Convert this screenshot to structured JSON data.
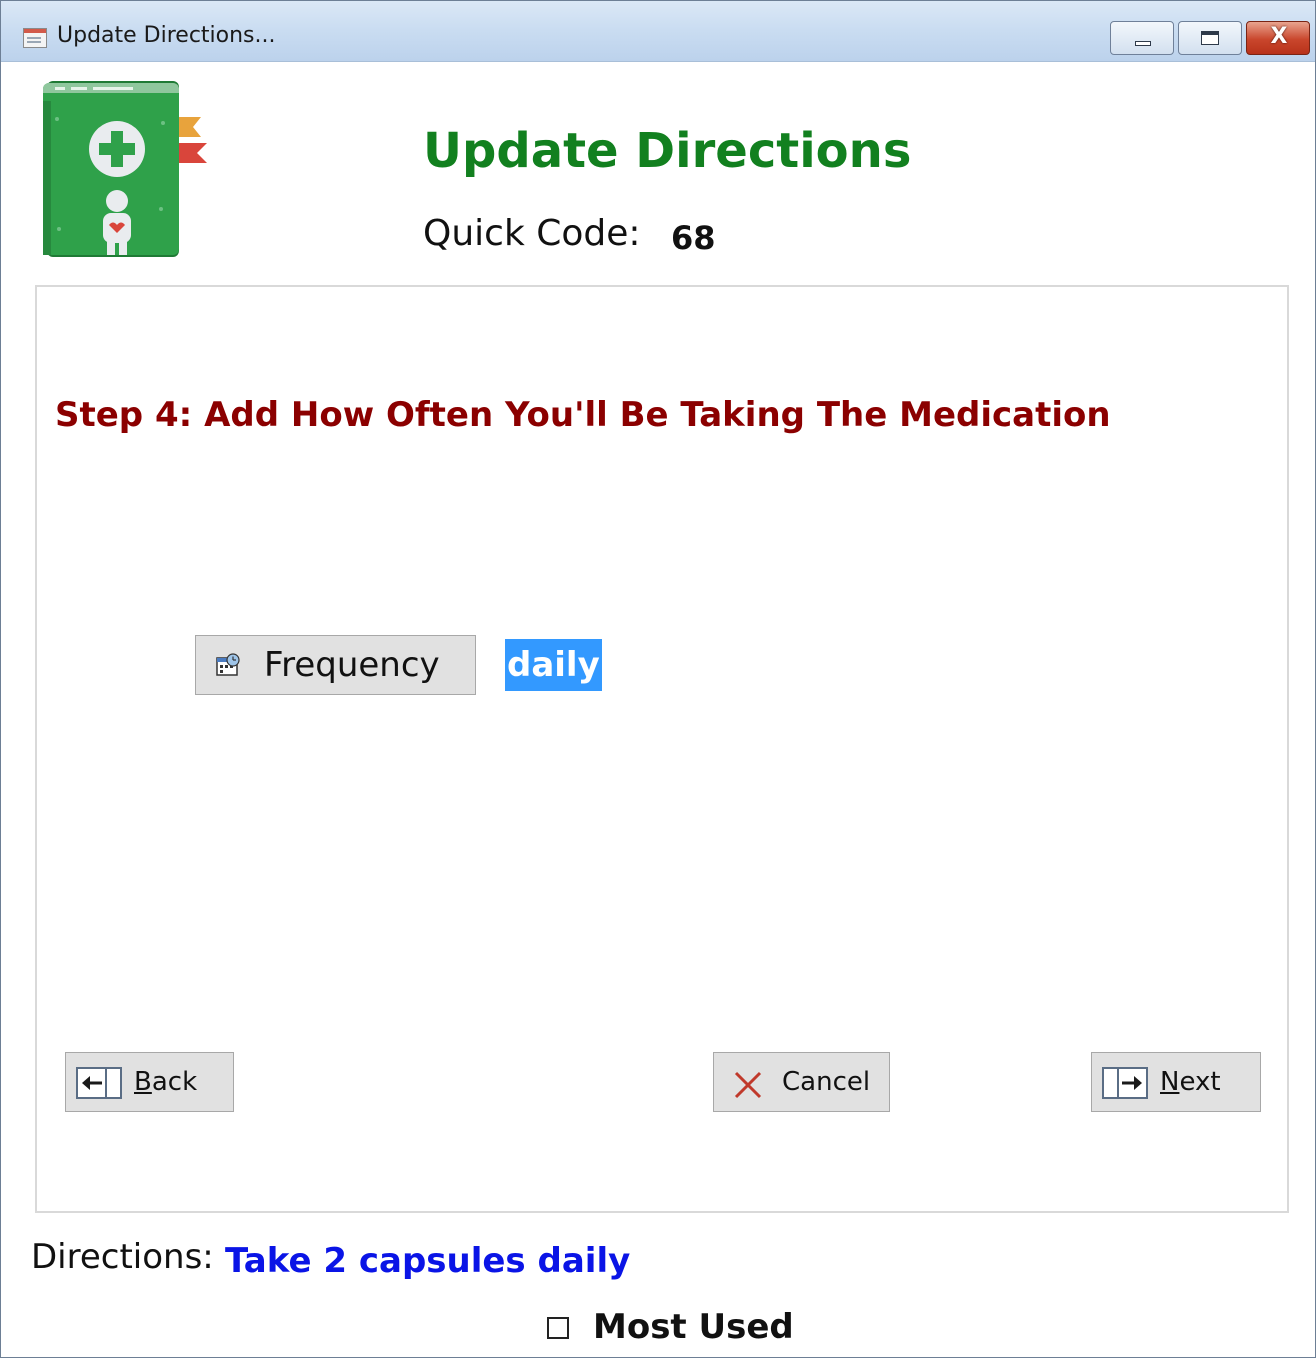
{
  "window": {
    "title": "Update Directions...",
    "icon": "form-window-icon",
    "controls": {
      "minimize_icon": "minimize-icon",
      "maximize_icon": "maximize-icon",
      "close_label": "X"
    }
  },
  "header": {
    "logo_icon": "medical-book-icon",
    "title": "Update Directions",
    "quick_code_label": "Quick Code:",
    "quick_code_value": "68"
  },
  "step": {
    "title": "Step 4: Add How Often You'll Be Taking The Medication",
    "frequency_button_label": "Frequency",
    "frequency_button_icon": "frequency-icon",
    "frequency_value": "daily"
  },
  "navigation": {
    "back_label": "Back",
    "back_icon": "back-arrow-icon",
    "cancel_label": "Cancel",
    "cancel_icon": "cancel-x-icon",
    "next_label": "Next",
    "next_icon": "next-arrow-icon"
  },
  "footer": {
    "directions_label": "Directions:",
    "directions_value": "Take 2 capsules daily",
    "most_used_label": "Most Used",
    "most_used_checked": false
  },
  "colors": {
    "title_green": "#12801f",
    "step_red": "#8b0000",
    "directions_blue": "#0a14e6",
    "selection_blue": "#3399ff"
  }
}
